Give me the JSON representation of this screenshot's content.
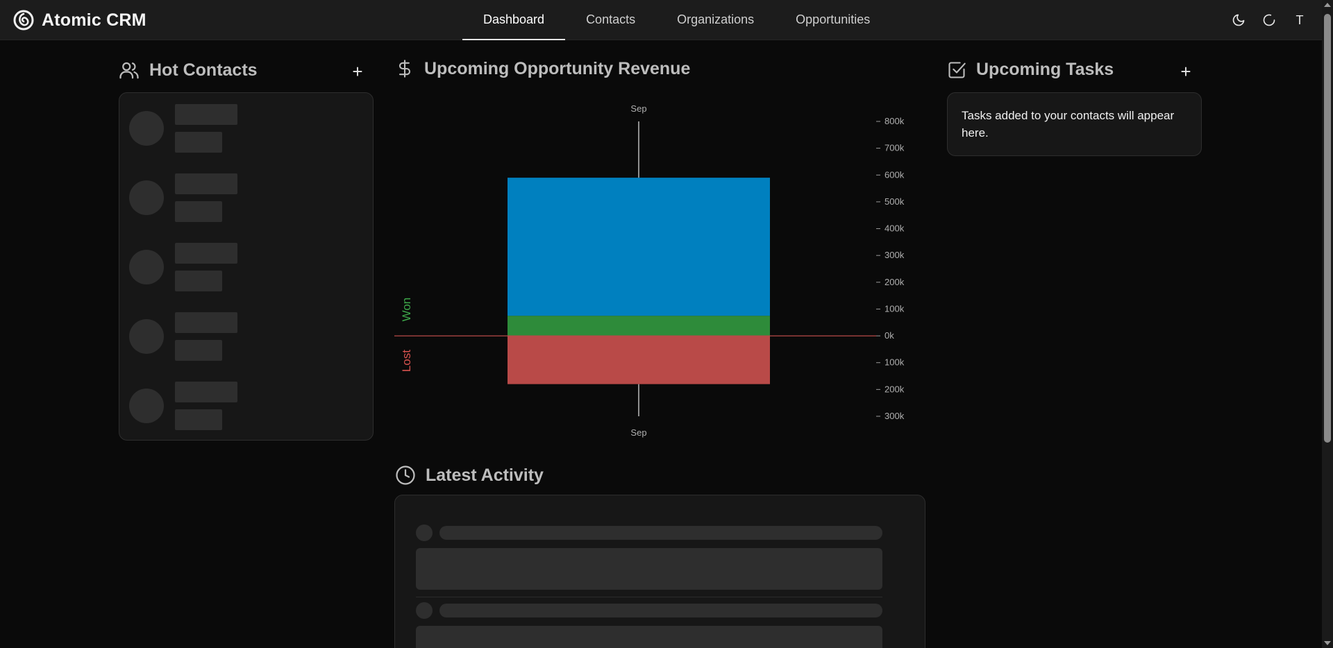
{
  "app": {
    "name": "Atomic CRM"
  },
  "nav": {
    "tabs": [
      {
        "label": "Dashboard",
        "active": true
      },
      {
        "label": "Contacts",
        "active": false
      },
      {
        "label": "Organizations",
        "active": false
      },
      {
        "label": "Opportunities",
        "active": false
      }
    ]
  },
  "header_actions": {
    "user_initial": "T",
    "theme_icon": "moon-icon",
    "refresh_icon": "refresh-icon"
  },
  "hot_contacts": {
    "title": "Hot Contacts",
    "add_icon": "plus-icon",
    "loading": true,
    "skeleton_count": 5
  },
  "revenue": {
    "title": "Upcoming Opportunity Revenue",
    "icon": "dollar-icon"
  },
  "chart_data": {
    "type": "bar",
    "stacked": true,
    "categories": [
      "Sep"
    ],
    "series": [
      {
        "name": "Won",
        "values": [
          75000
        ],
        "color": "#2e8b3a"
      },
      {
        "name": "",
        "values": [
          515000
        ],
        "color": "#0080bf"
      },
      {
        "name": "Lost",
        "values": [
          -180000
        ],
        "color": "#b94a48"
      }
    ],
    "y_ticks": [
      "800k",
      "700k",
      "600k",
      "500k",
      "400k",
      "300k",
      "200k",
      "100k",
      "0k",
      "100k",
      "200k",
      "300k"
    ],
    "ylim": [
      -300000,
      800000
    ],
    "side_labels": {
      "top": "Won",
      "bottom": "Lost"
    },
    "zero_line_color": "#b94a48",
    "axis_position": "right"
  },
  "tasks": {
    "title": "Upcoming Tasks",
    "add_icon": "plus-icon",
    "empty_message": "Tasks added to your contacts will appear here."
  },
  "activity": {
    "title": "Latest Activity",
    "icon": "clock-icon",
    "loading": true
  }
}
